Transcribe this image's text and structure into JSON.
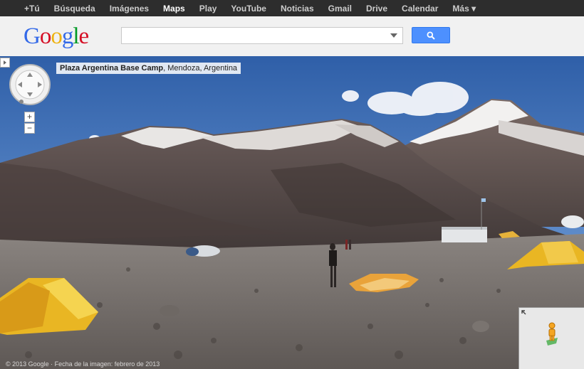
{
  "topbar": {
    "items": [
      {
        "label": "+Tú"
      },
      {
        "label": "Búsqueda"
      },
      {
        "label": "Imágenes"
      },
      {
        "label": "Maps",
        "active": true
      },
      {
        "label": "Play"
      },
      {
        "label": "YouTube"
      },
      {
        "label": "Noticias"
      },
      {
        "label": "Gmail"
      },
      {
        "label": "Drive"
      },
      {
        "label": "Calendar"
      },
      {
        "label": "Más ▾"
      }
    ]
  },
  "header": {
    "logo_letters": [
      "G",
      "o",
      "o",
      "g",
      "l",
      "e"
    ],
    "logo_colors": [
      "#3369e8",
      "#d50f25",
      "#eeb211",
      "#3369e8",
      "#009925",
      "#d50f25"
    ],
    "search_value": "",
    "search_icon": "magnifier-icon"
  },
  "streetview": {
    "location_name": "Plaza Argentina Base Camp",
    "location_rest": ", Mendoza, Argentina",
    "zoom_in": "+",
    "zoom_out": "−",
    "copyright": "© 2013 Google · Fecha de la imagen: febrero de 2013"
  },
  "colors": {
    "accent": "#4d90fe",
    "topbar_bg": "#2d2d2d"
  }
}
